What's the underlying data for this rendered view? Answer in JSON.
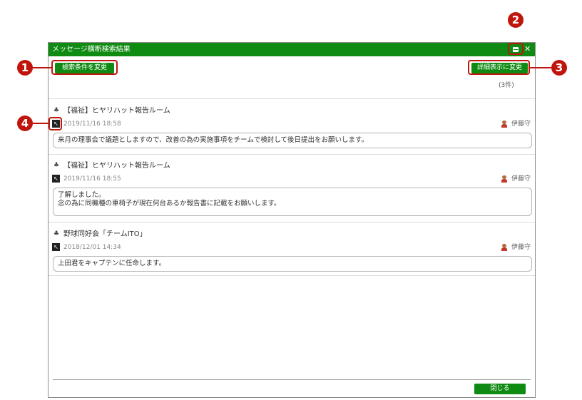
{
  "window": {
    "title": "メッセージ横断検索結果"
  },
  "toolbar": {
    "search_conditions_label": "検索条件を変更",
    "detail_view_label": "詳細表示に変更",
    "result_count": "(3件)"
  },
  "messages": [
    {
      "room": "【福祉】ヒヤリハット報告ルーム",
      "date": "2019/11/16 18:58",
      "user": "伊藤守",
      "lines": [
        "来月の理事会で議題としますので、改善の為の実施事項をチームで検討して後日提出をお願いします。"
      ]
    },
    {
      "room": "【福祉】ヒヤリハット報告ルーム",
      "date": "2019/11/16 18:55",
      "user": "伊藤守",
      "lines": [
        "了解しました。",
        "念の為に同機種の車椅子が現在何台あるか報告書に記載をお願いします。"
      ]
    },
    {
      "room": "野球同好会「チームITO」",
      "date": "2018/12/01 14:34",
      "user": "伊藤守",
      "lines": [
        "上田君をキャプテンに任命します。"
      ]
    }
  ],
  "footer": {
    "close_label": "閉じる"
  },
  "callouts": [
    "1",
    "2",
    "3",
    "4"
  ],
  "colors": {
    "accent": "#0f8a12",
    "callout": "#c0150c"
  },
  "icons": {
    "room": "room-icon",
    "jump": "jump-to-message-icon",
    "user": "user-avatar-icon"
  }
}
